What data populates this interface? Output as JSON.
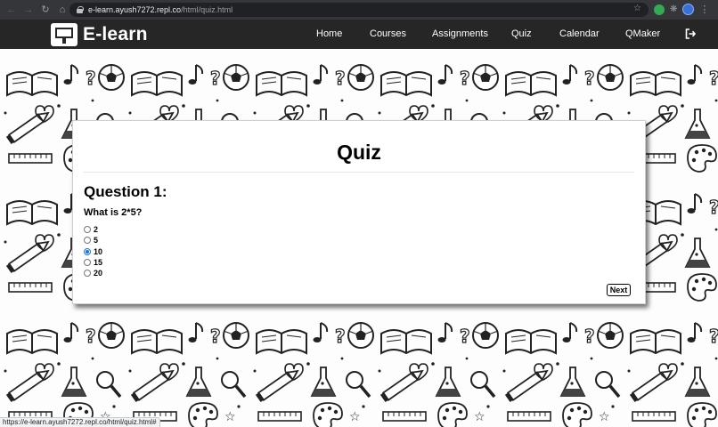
{
  "browser": {
    "url_host": "e-learn.ayush7272.repl.co",
    "url_path": "/html/quiz.html",
    "back_icon": "arrow-left-icon",
    "forward_icon": "arrow-right-icon",
    "reload_icon": "reload-icon",
    "home_icon": "home-icon"
  },
  "navbar": {
    "brand": "E-learn",
    "links": [
      "Home",
      "Courses",
      "Assignments",
      "Quiz",
      "Calendar",
      "QMaker"
    ],
    "logout_icon": "logout-icon",
    "background": "#262626"
  },
  "quiz": {
    "title": "Quiz",
    "question_heading": "Question 1:",
    "question_text": "What is 2*5?",
    "options": [
      "2",
      "5",
      "10",
      "15",
      "20"
    ],
    "selected_index": 2,
    "next_label": "Next"
  },
  "status_bar": {
    "text": "https://e-learn.ayush7272.repl.co/html/quiz.html#"
  }
}
